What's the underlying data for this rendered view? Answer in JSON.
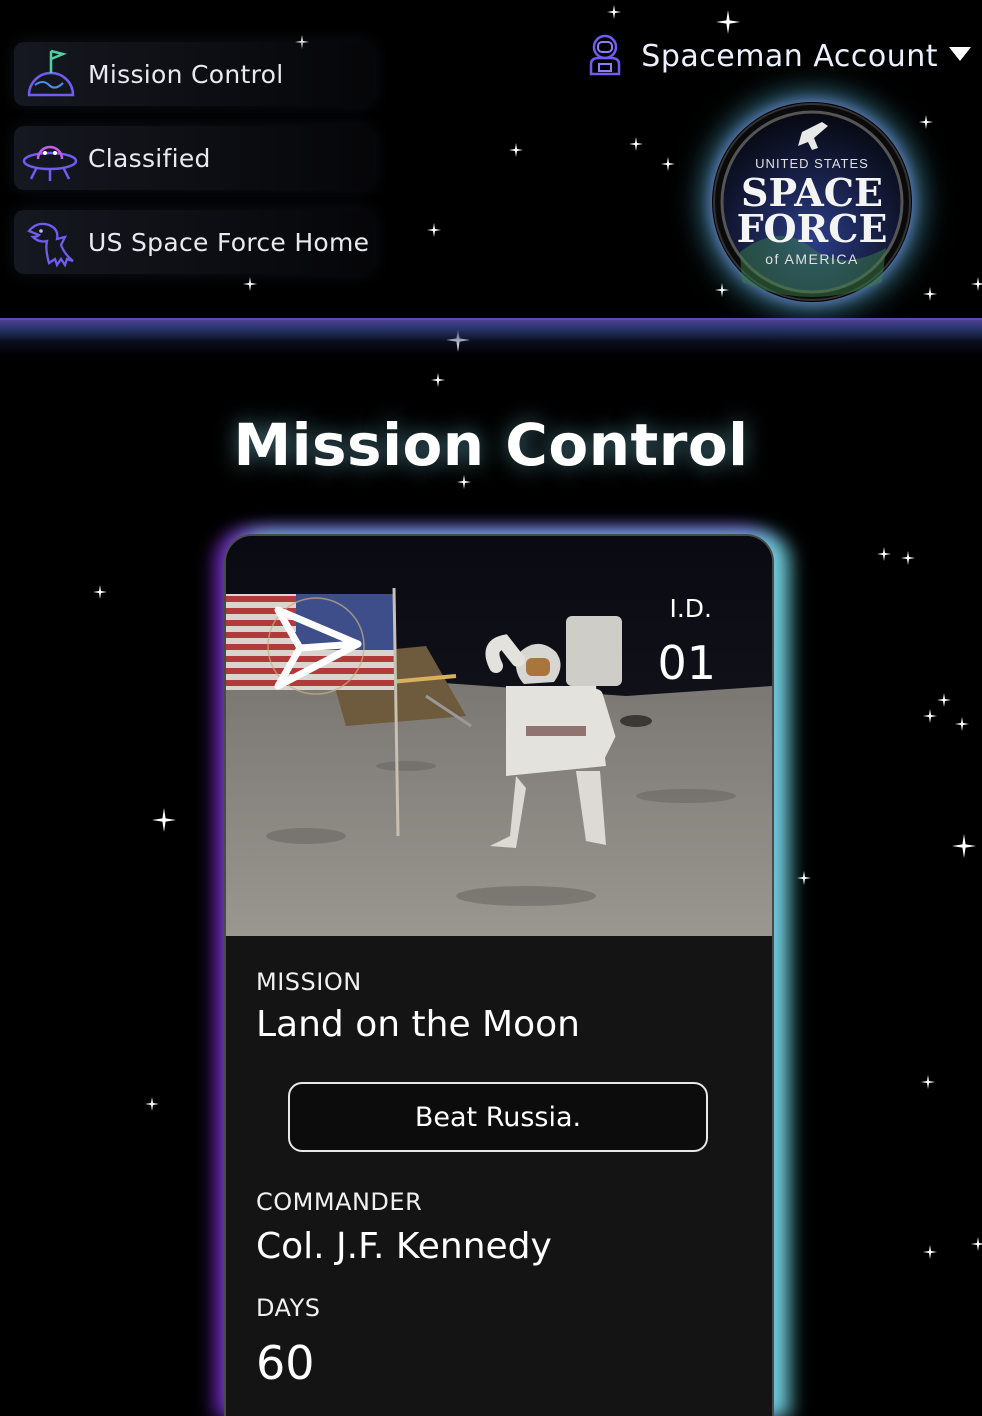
{
  "nav": {
    "items": [
      {
        "label": "Mission Control",
        "icon": "planet-flag-icon"
      },
      {
        "label": "Classified",
        "icon": "alien-ufo-icon"
      },
      {
        "label": "US Space Force Home",
        "icon": "eagle-icon"
      }
    ]
  },
  "account": {
    "label": "Spaceman Account",
    "icon": "astronaut-icon",
    "caret_icon": "caret-down-icon"
  },
  "logo": {
    "line1": "UNITED STATES",
    "line2": "SPACE",
    "line3": "FORCE",
    "line4": "of AMERICA"
  },
  "page": {
    "title": "Mission Control"
  },
  "card": {
    "id_label": "I.D.",
    "id_value": "01",
    "mission_label": "MISSION",
    "mission_value": "Land on the Moon",
    "motto_button": "Beat Russia.",
    "commander_label": "COMMANDER",
    "commander_value": "Col. J.F. Kennedy",
    "days_label": "DAYS",
    "days_value": "60"
  },
  "colors": {
    "background": "#000000",
    "accent_cyan": "#6fe3ef",
    "accent_purple": "#7a3bd6",
    "icon_purple": "#6f5cf0",
    "card_body": "#141414"
  }
}
